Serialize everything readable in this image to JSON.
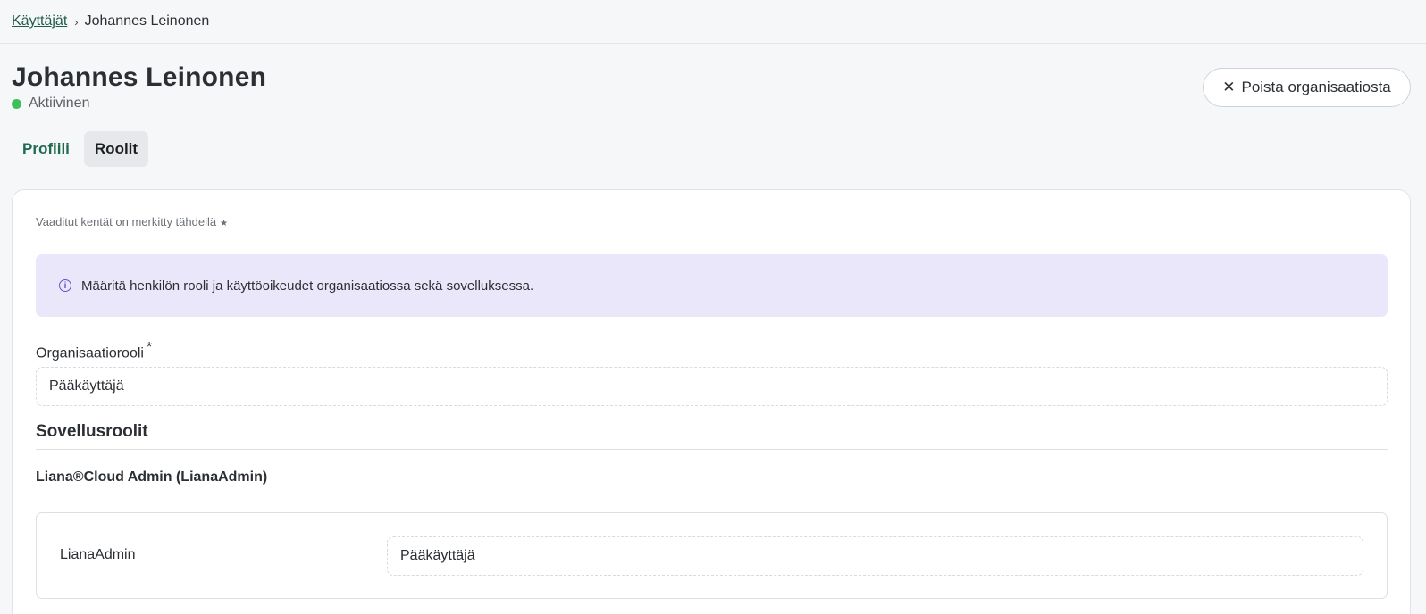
{
  "breadcrumb": {
    "parent": "Käyttäjät",
    "separator": "›",
    "current": "Johannes Leinonen"
  },
  "user": {
    "name": "Johannes Leinonen",
    "status": "Aktiivinen",
    "status_color": "#3fbf5a"
  },
  "actions": {
    "remove_icon": "close-icon",
    "remove_label": "Poista organisaatiosta"
  },
  "tabs": [
    {
      "label": "Profiili",
      "active": false
    },
    {
      "label": "Roolit",
      "active": true
    }
  ],
  "form": {
    "required_note": "Vaaditut kentät on merkitty tähdellä",
    "required_mark": "★",
    "info_text": "Määritä henkilön rooli ja käyttöoikeudet organisaatiossa sekä sovelluksessa.",
    "org_role_label": "Organisaatiorooli",
    "org_role_required": "*",
    "org_role_value": "Pääkäyttäjä",
    "app_roles_title": "Sovellusroolit",
    "app": {
      "name": "Liana®Cloud Admin (LianaAdmin)",
      "role_label": "LianaAdmin",
      "role_value": "Pääkäyttäjä"
    }
  },
  "colors": {
    "accent": "#1f6b4f",
    "info_bg": "#ebe7fa",
    "info_icon": "#6a4fd1"
  }
}
